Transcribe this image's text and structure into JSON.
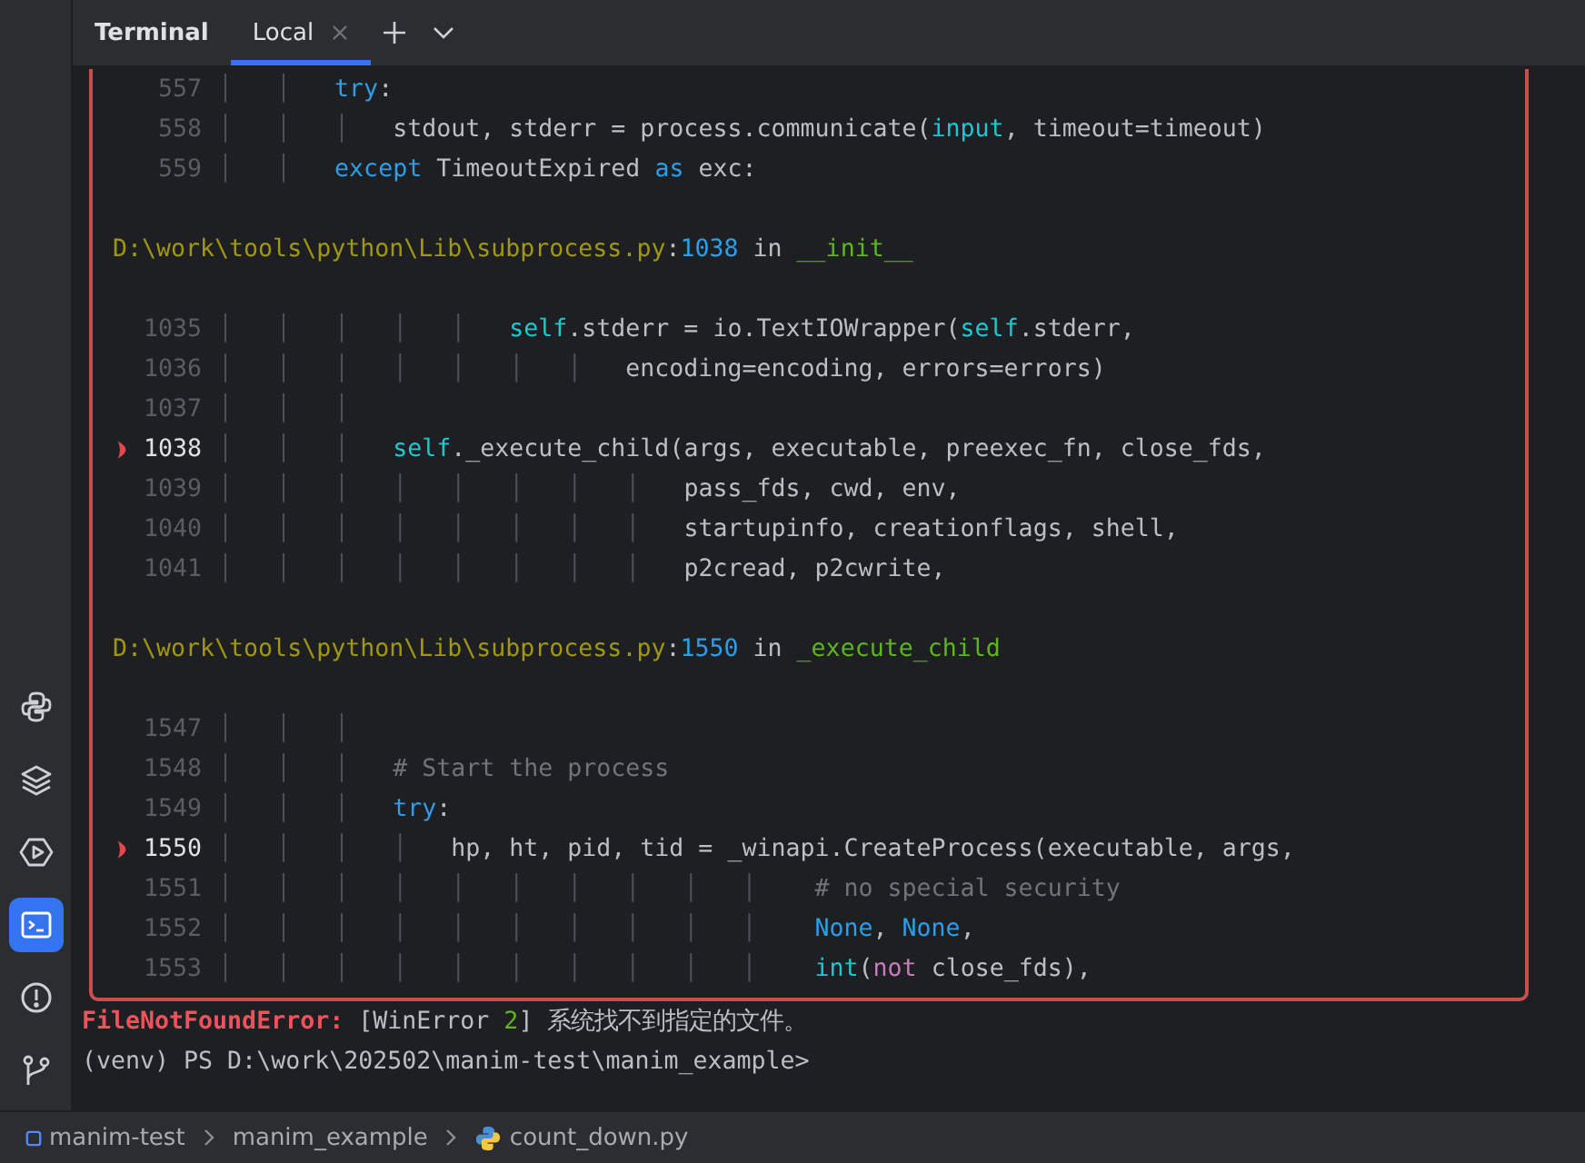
{
  "panel": {
    "title": "Terminal",
    "tabs": [
      {
        "label": "Local",
        "selected": true
      }
    ]
  },
  "sidebar": {
    "items": [
      {
        "kind": "python",
        "selected": false
      },
      {
        "kind": "layers",
        "selected": false
      },
      {
        "kind": "run",
        "selected": false
      },
      {
        "kind": "terminal",
        "selected": true
      },
      {
        "kind": "problems",
        "selected": false
      },
      {
        "kind": "git",
        "selected": false
      }
    ]
  },
  "traceback": {
    "lines": [
      {
        "kind": "code",
        "number": "557",
        "current": false,
        "segments": [
          {
            "text": "│   │   ",
            "kind": "guide"
          },
          {
            "text": "try",
            "kind": "keyword"
          },
          {
            "text": ":",
            "kind": "plain"
          }
        ]
      },
      {
        "kind": "code",
        "number": "558",
        "current": false,
        "segments": [
          {
            "text": "│   │   │   ",
            "kind": "guide"
          },
          {
            "text": "stdout, stderr = process.communicate(",
            "kind": "plain"
          },
          {
            "text": "input",
            "kind": "builtin"
          },
          {
            "text": ", timeout=timeout)",
            "kind": "plain"
          }
        ]
      },
      {
        "kind": "code",
        "number": "559",
        "current": false,
        "segments": [
          {
            "text": "│   │   ",
            "kind": "guide"
          },
          {
            "text": "except",
            "kind": "keyword"
          },
          {
            "text": " TimeoutExpired ",
            "kind": "plain"
          },
          {
            "text": "as",
            "kind": "keyword"
          },
          {
            "text": " exc:",
            "kind": "plain"
          }
        ]
      },
      {
        "kind": "blank"
      },
      {
        "kind": "location",
        "segments": [
          {
            "text": "D:\\work\\tools\\python\\Lib\\subprocess.py",
            "kind": "path"
          },
          {
            "text": ":",
            "kind": "plain"
          },
          {
            "text": "1038",
            "kind": "lineno"
          },
          {
            "text": " in ",
            "kind": "plain"
          },
          {
            "text": "__init__",
            "kind": "func"
          }
        ]
      },
      {
        "kind": "blank"
      },
      {
        "kind": "code",
        "number": "1035",
        "current": false,
        "segments": [
          {
            "text": "│   │   │   │   │   ",
            "kind": "guide"
          },
          {
            "text": "self",
            "kind": "builtin"
          },
          {
            "text": ".stderr = io.TextIOWrapper(",
            "kind": "plain"
          },
          {
            "text": "self",
            "kind": "builtin"
          },
          {
            "text": ".stderr,",
            "kind": "plain"
          }
        ]
      },
      {
        "kind": "code",
        "number": "1036",
        "current": false,
        "segments": [
          {
            "text": "│   │   │   │   │   │   │   ",
            "kind": "guide"
          },
          {
            "text": "encoding=encoding, errors=errors)",
            "kind": "plain"
          }
        ]
      },
      {
        "kind": "code",
        "number": "1037",
        "current": false,
        "segments": [
          {
            "text": "│   │   │",
            "kind": "guide"
          }
        ]
      },
      {
        "kind": "code",
        "number": "1038",
        "current": true,
        "segments": [
          {
            "text": "│   │   │   ",
            "kind": "guide"
          },
          {
            "text": "self",
            "kind": "builtin"
          },
          {
            "text": "._execute_child(args, executable, preexec_fn, close_fds,",
            "kind": "plain"
          }
        ]
      },
      {
        "kind": "code",
        "number": "1039",
        "current": false,
        "segments": [
          {
            "text": "│   │   │   │   │   │   │   │   ",
            "kind": "guide"
          },
          {
            "text": "pass_fds, cwd, env,",
            "kind": "plain"
          }
        ]
      },
      {
        "kind": "code",
        "number": "1040",
        "current": false,
        "segments": [
          {
            "text": "│   │   │   │   │   │   │   │   ",
            "kind": "guide"
          },
          {
            "text": "startupinfo, creationflags, shell,",
            "kind": "plain"
          }
        ]
      },
      {
        "kind": "code",
        "number": "1041",
        "current": false,
        "segments": [
          {
            "text": "│   │   │   │   │   │   │   │   ",
            "kind": "guide"
          },
          {
            "text": "p2cread, p2cwrite,",
            "kind": "plain"
          }
        ]
      },
      {
        "kind": "blank"
      },
      {
        "kind": "location",
        "segments": [
          {
            "text": "D:\\work\\tools\\python\\Lib\\subprocess.py",
            "kind": "path"
          },
          {
            "text": ":",
            "kind": "plain"
          },
          {
            "text": "1550",
            "kind": "lineno"
          },
          {
            "text": " in ",
            "kind": "plain"
          },
          {
            "text": "_execute_child",
            "kind": "func"
          }
        ]
      },
      {
        "kind": "blank"
      },
      {
        "kind": "code",
        "number": "1547",
        "current": false,
        "segments": [
          {
            "text": "│   │   │",
            "kind": "guide"
          }
        ]
      },
      {
        "kind": "code",
        "number": "1548",
        "current": false,
        "segments": [
          {
            "text": "│   │   │   ",
            "kind": "guide"
          },
          {
            "text": "# Start the process",
            "kind": "comment"
          }
        ]
      },
      {
        "kind": "code",
        "number": "1549",
        "current": false,
        "segments": [
          {
            "text": "│   │   │   ",
            "kind": "guide"
          },
          {
            "text": "try",
            "kind": "keyword"
          },
          {
            "text": ":",
            "kind": "plain"
          }
        ]
      },
      {
        "kind": "code",
        "number": "1550",
        "current": true,
        "segments": [
          {
            "text": "│   │   │   │   ",
            "kind": "guide"
          },
          {
            "text": "hp, ht, pid, tid = _winapi.CreateProcess(executable, args,",
            "kind": "plain"
          }
        ]
      },
      {
        "kind": "code",
        "number": "1551",
        "current": false,
        "segments": [
          {
            "text": "│   │   │   │   │   │   │   │   │   │    ",
            "kind": "guide"
          },
          {
            "text": "# no special security",
            "kind": "comment"
          }
        ]
      },
      {
        "kind": "code",
        "number": "1552",
        "current": false,
        "segments": [
          {
            "text": "│   │   │   │   │   │   │   │   │   │    ",
            "kind": "guide"
          },
          {
            "text": "None",
            "kind": "keyword"
          },
          {
            "text": ", ",
            "kind": "plain"
          },
          {
            "text": "None",
            "kind": "keyword"
          },
          {
            "text": ",",
            "kind": "plain"
          }
        ]
      },
      {
        "kind": "code",
        "number": "1553",
        "current": false,
        "segments": [
          {
            "text": "│   │   │   │   │   │   │   │   │   │    ",
            "kind": "guide"
          },
          {
            "text": "int",
            "kind": "builtin"
          },
          {
            "text": "(",
            "kind": "plain"
          },
          {
            "text": "not",
            "kind": "operator"
          },
          {
            "text": " close_fds),",
            "kind": "plain"
          }
        ]
      }
    ]
  },
  "output": [
    {
      "segments": [
        {
          "text": "FileNotFoundError:",
          "kind": "error"
        },
        {
          "text": " [WinError ",
          "kind": "plain"
        },
        {
          "text": "2",
          "kind": "number"
        },
        {
          "text": "] 系统找不到指定的文件。",
          "kind": "plain"
        }
      ]
    },
    {
      "segments": [
        {
          "text": "(venv) PS D:\\work\\202502\\manim-test\\manim_example>",
          "kind": "plain"
        }
      ]
    }
  ],
  "breadcrumbs": [
    {
      "label": "manim-test",
      "kind": "module"
    },
    {
      "label": "manim_example",
      "kind": "folder"
    },
    {
      "label": "count_down.py",
      "kind": "python"
    }
  ]
}
